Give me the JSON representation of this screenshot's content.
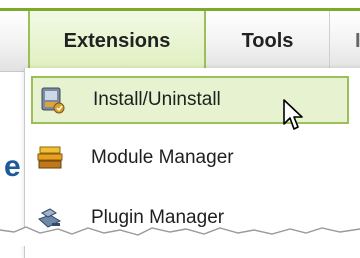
{
  "menubar": {
    "items": [
      {
        "label": "Extensions",
        "active": true
      },
      {
        "label": "Tools",
        "active": false
      },
      {
        "label": "I",
        "active": false
      }
    ],
    "accent_color": "#7daa2c"
  },
  "dropdown": {
    "items": [
      {
        "label": "Install/Uninstall",
        "icon": "install-box-icon",
        "hover": true
      },
      {
        "label": "Module Manager",
        "icon": "module-manager-icon",
        "hover": false
      },
      {
        "label": "Plugin Manager",
        "icon": "plugin-manager-icon",
        "hover": false
      }
    ],
    "hover_bg": "#e6f2d0",
    "hover_border": "#9cbf58"
  },
  "background_text": "e"
}
